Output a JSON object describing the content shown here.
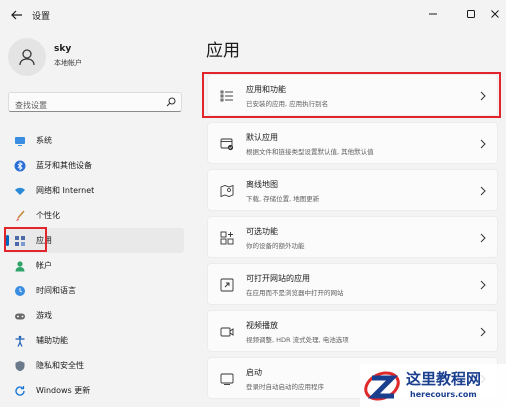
{
  "window": {
    "title": "设置"
  },
  "profile": {
    "name": "sky",
    "account_type": "本地帐户"
  },
  "search": {
    "placeholder": "查找设置"
  },
  "nav": {
    "items": [
      {
        "label": "系统",
        "icon": "monitor-icon"
      },
      {
        "label": "蓝牙和其他设备",
        "icon": "bluetooth-icon"
      },
      {
        "label": "网络和 Internet",
        "icon": "wifi-icon"
      },
      {
        "label": "个性化",
        "icon": "brush-icon"
      },
      {
        "label": "应用",
        "icon": "apps-icon",
        "active": true
      },
      {
        "label": "帐户",
        "icon": "person-icon"
      },
      {
        "label": "时间和语言",
        "icon": "globe-clock-icon"
      },
      {
        "label": "游戏",
        "icon": "gamepad-icon"
      },
      {
        "label": "辅助功能",
        "icon": "accessibility-icon"
      },
      {
        "label": "隐私和安全性",
        "icon": "shield-icon"
      },
      {
        "label": "Windows 更新",
        "icon": "update-icon"
      }
    ]
  },
  "main": {
    "title": "应用",
    "cards": [
      {
        "title": "应用和功能",
        "subtitle": "已安装的应用, 应用执行别名",
        "icon": "list-icon"
      },
      {
        "title": "默认应用",
        "subtitle": "根据文件和链接类型设置默认值, 其他默认值",
        "icon": "default-apps-icon"
      },
      {
        "title": "离线地图",
        "subtitle": "下载, 存储位置, 地图更新",
        "icon": "map-icon"
      },
      {
        "title": "可选功能",
        "subtitle": "你的设备的额外功能",
        "icon": "optional-features-icon"
      },
      {
        "title": "可打开网站的应用",
        "subtitle": "在应用而不是浏览器中打开的网站",
        "icon": "web-apps-icon"
      },
      {
        "title": "视频播放",
        "subtitle": "视频调整, HDR 流式处理, 电池选项",
        "icon": "video-icon"
      },
      {
        "title": "启动",
        "subtitle": "登录时自动启动的应用程序",
        "icon": "startup-icon"
      }
    ]
  },
  "watermark": {
    "title": "这里教程网",
    "url": "herecours.com"
  },
  "colors": {
    "accent": "#0067c0",
    "highlight_box": "#e0252b"
  }
}
